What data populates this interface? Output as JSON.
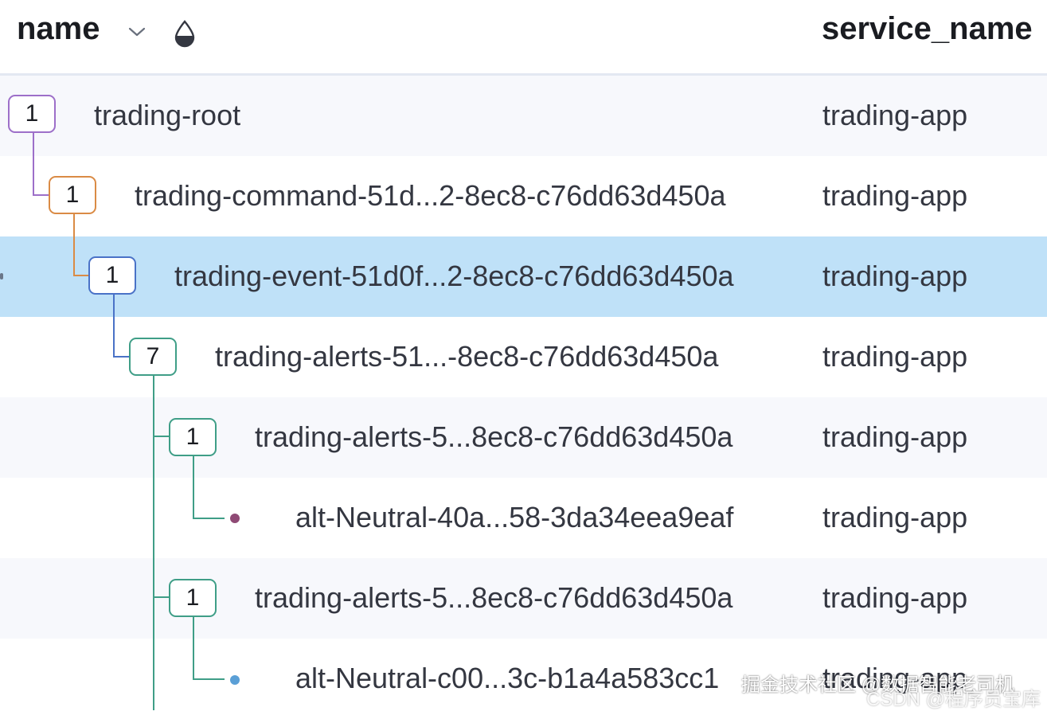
{
  "header": {
    "name_label": "name",
    "service_label": "service_name",
    "sort_icon": "chevron-down-icon",
    "color_icon": "drop-icon"
  },
  "rows": [
    {
      "badge": "1",
      "badge_color": "#9d6fc9",
      "name": "trading-root",
      "service": "trading-app"
    },
    {
      "badge": "1",
      "badge_color": "#da8b45",
      "name": "trading-command-51d...2-8ec8-c76dd63d450a",
      "service": "trading-app"
    },
    {
      "badge": "1",
      "badge_color": "#4a72c7",
      "name": "trading-event-51d0f...2-8ec8-c76dd63d450a",
      "service": "trading-app",
      "selected": true
    },
    {
      "badge": "7",
      "badge_color": "#3f9e87",
      "name": "trading-alerts-51...-8ec8-c76dd63d450a",
      "service": "trading-app"
    },
    {
      "badge": "1",
      "badge_color": "#3f9e87",
      "name": "trading-alerts-5...8ec8-c76dd63d450a",
      "service": "trading-app"
    },
    {
      "dot_color": "#8f4a75",
      "name": "alt-Neutral-40a...58-3da34eea9eaf",
      "service": "trading-app"
    },
    {
      "badge": "1",
      "badge_color": "#3f9e87",
      "name": "trading-alerts-5...8ec8-c76dd63d450a",
      "service": "trading-app"
    },
    {
      "dot_color": "#5a9fd6",
      "name": "alt-Neutral-c00...3c-b1a4a583cc1",
      "service": "trading-app"
    }
  ],
  "watermark": {
    "line1": "掘金技术社区 @数据智能老司机",
    "line2": "CSDN @程序员宝库"
  }
}
